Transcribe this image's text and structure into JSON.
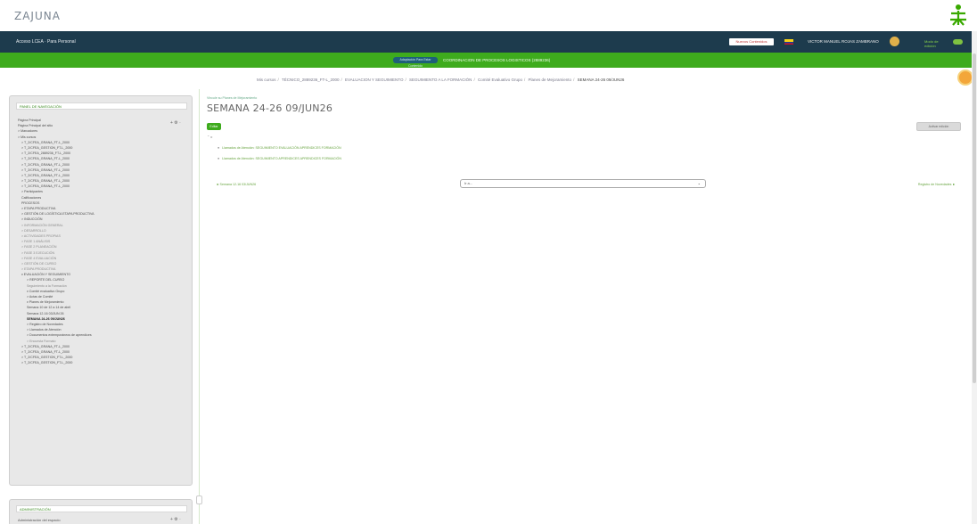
{
  "branding": {
    "logo_text": "ZAJUNA"
  },
  "top_nav": {
    "site_name": "Acceso LCEA · Para Personal",
    "notice_button": "Nuevos Contenidos",
    "user_name": "VICTOR MANUEL ROJAS ZAMBRANO",
    "edit_mode_label": "Modo de edición"
  },
  "green_bar": {
    "view_button": "Adaptación Para Estar Contenido",
    "course_name": "COORDINACION DE PROCESOS LOGISTICOS (2889236)"
  },
  "breadcrumb": {
    "items": [
      "Mis cursos",
      "TÉCNICO_2889236_FT-L_2000",
      "EVALUACION Y SEGUIMIENTO",
      "SEGUIMIENTO A LA FORMACIÓN",
      "Comité Evaluativo Grupo",
      "Planes de Mejoramiento"
    ],
    "current": "SEMANA 24-26 09/JUN26"
  },
  "left_panel": {
    "title": "PANEL DE NAVEGACIÓN",
    "tree": [
      {
        "label": "Página Principal",
        "cls": ""
      },
      {
        "label": "Página Principal del sitio",
        "cls": ""
      },
      {
        "label": "> Marcadores",
        "cls": ""
      },
      {
        "label": "> Mis cursos",
        "cls": ""
      },
      {
        "label": "> T_2/CFEA_GRANA_FT-L_2000",
        "cls": ""
      },
      {
        "label": "> T_2/CFEA_GESTION_FT-L_2000",
        "cls": ""
      },
      {
        "label": "> T_2/CFEA_2889236_FT-L_2000",
        "cls": ""
      },
      {
        "label": "> T_2/CFEA_GRANA_FT-L_2000",
        "cls": ""
      },
      {
        "label": "> T_2/CFEA_GRANA_FT-L_2000",
        "cls": ""
      },
      {
        "label": "> T_2/CFEA_GRANA_FT-L_2000",
        "cls": ""
      },
      {
        "label": "> T_2/CFEA_GRANA_FT-L_2000",
        "cls": ""
      },
      {
        "label": "> T_2/CFEA_GRANA_FT-L_2000",
        "cls": ""
      },
      {
        "label": "> T_2/CFEA_GRANA_FT-L_2000",
        "cls": ""
      },
      {
        "label": "> Participantes",
        "cls": ""
      },
      {
        "label": "Calificaciones",
        "cls": ""
      },
      {
        "label": "PROCESOS",
        "cls": ""
      },
      {
        "label": "> ETAPA PRODUCTIVA",
        "cls": ""
      },
      {
        "label": "> GESTIÓN DE LOGÍSTICA ETAPA PRODUCTIVA",
        "cls": ""
      },
      {
        "label": "> INDUCCIÓN",
        "cls": ""
      },
      {
        "label": "> INFORMACIÓN GENERAL",
        "cls": "muted"
      },
      {
        "label": "> DESARROLLO",
        "cls": "muted"
      },
      {
        "label": "> ACTIVIDADES PROPIAS",
        "cls": "muted"
      },
      {
        "label": "> FASE 1 ANÁLISIS",
        "cls": "muted"
      },
      {
        "label": "> FASE 2 PLANEACIÓN",
        "cls": "muted"
      },
      {
        "label": "> FASE 3 EJECUCIÓN",
        "cls": "muted"
      },
      {
        "label": "> FASE 4 EVALUACIÓN",
        "cls": "muted"
      },
      {
        "label": "> GESTIÓN DE CURSO",
        "cls": "muted"
      },
      {
        "label": "> ETAPA PRODUCTIVA",
        "cls": "muted"
      },
      {
        "label": "v EVALUACIÓN Y SEGUIMIENTO",
        "cls": ""
      },
      {
        "label": "> REPORTE DEL CURSO",
        "cls": ""
      },
      {
        "label": "Seguimiento a la Formación",
        "cls": "muted"
      },
      {
        "label": "v Comité evaluativo Grupo",
        "cls": ""
      },
      {
        "label": "> Actas de Comité",
        "cls": ""
      },
      {
        "label": "v Planes de Mejoramiento",
        "cls": ""
      },
      {
        "label": "Semana 10 de 12 a 14 de abril",
        "cls": ""
      },
      {
        "label": "Semana 12-16 03/JUN 26",
        "cls": ""
      },
      {
        "label": "SEMANA 24-26 09/JUN26",
        "cls": "active"
      },
      {
        "label": "> Registro de Novedades",
        "cls": ""
      },
      {
        "label": "> Llamados de Atención",
        "cls": ""
      },
      {
        "label": "> Documentos extemporáneos de aprendices",
        "cls": ""
      },
      {
        "label": "> Encuesta Formato",
        "cls": "muted"
      },
      {
        "label": "> T_2/CFEA_GRANA_FT-L_2000",
        "cls": ""
      },
      {
        "label": "> T_2/CFEA_GRANA_FT-L_2000",
        "cls": ""
      },
      {
        "label": "> T_2/CFEA_GESTION_FT-L_2000",
        "cls": ""
      },
      {
        "label": "> T_2/CFEA_GESTION_FT-L_2000",
        "cls": ""
      }
    ]
  },
  "admin_panel": {
    "title": "ADMINISTRACIÓN",
    "item": "Administración del espacio"
  },
  "main": {
    "mini_crumb": "Vincule su Planes de Mejoramiento",
    "title": "SEMANA 24-26 09/JUN26",
    "save_button": "Editar",
    "turn_edit_button": "Activar edición",
    "activities": [
      "Llamados de Atención: SEGUIMIENTO EVALUACIÓN APRENDICES FORMACIÓN",
      "Llamados de Atención: SEGUIMIENTO APRENDICES APRENDICES FORMACIÓN"
    ],
    "prev_link": "◄ Semana 12-16 03/JUN26",
    "next_link": "Registro de Novedades ►",
    "jump_value": "Ir a..."
  }
}
